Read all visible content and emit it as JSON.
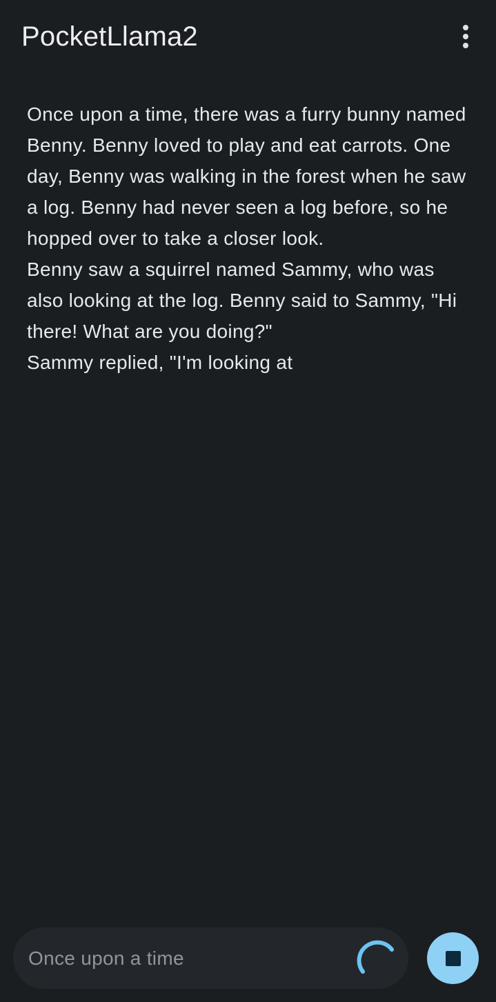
{
  "app": {
    "title": "PocketLlama2",
    "menu_icon": "more-vert-icon"
  },
  "story": {
    "text": "Once upon a time, there was a furry bunny named Benny. Benny loved to play and eat carrots. One day, Benny was walking in the forest when he saw a log. Benny had never seen a log before, so he hopped over to take a closer look.\nBenny saw a squirrel named Sammy, who was also looking at the log. Benny said to Sammy, \"Hi there! What are you doing?\"\nSammy replied, \"I'm looking at"
  },
  "input": {
    "value": "Once upon a time",
    "loading_icon": "loading-spinner-icon"
  },
  "stop_button": {
    "icon": "stop-icon"
  },
  "colors": {
    "background": "#1b1e21",
    "input_background": "#23272b",
    "accent": "#8fd0f5",
    "spinner": "#6cc3f2",
    "stop_icon": "#0c2a3d"
  }
}
